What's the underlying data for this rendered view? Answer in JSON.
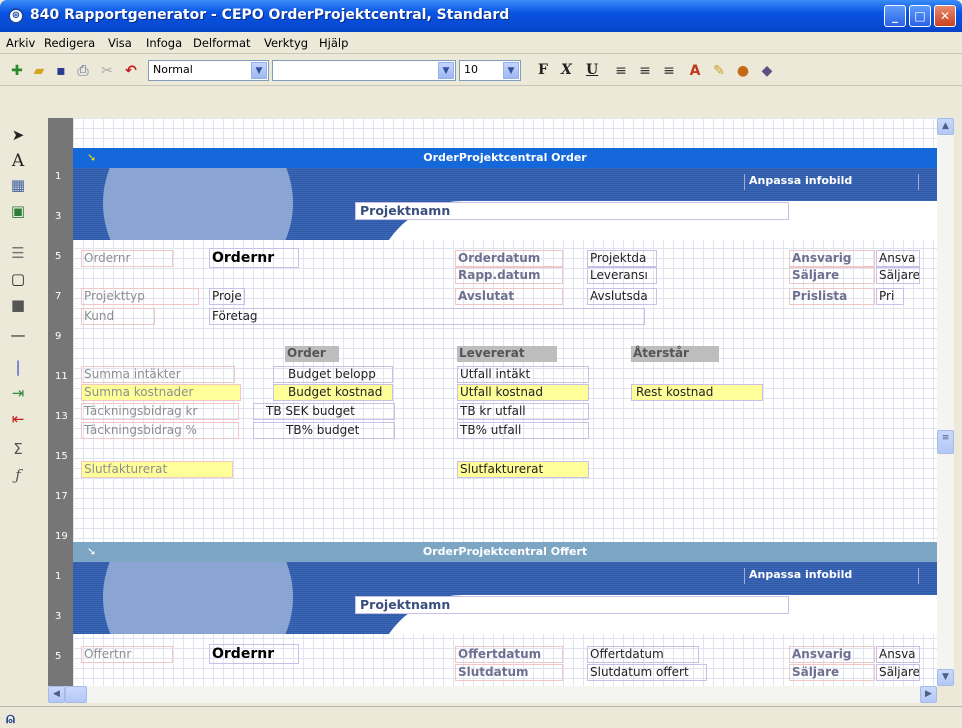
{
  "window": {
    "title": "840 Rapportgenerator - CEPO  OrderProjektcentral, Standard",
    "minimize": "_",
    "maximize": "□",
    "close": "✕"
  },
  "menu": [
    "Arkiv",
    "Redigera",
    "Visa",
    "Infoga",
    "Delformat",
    "Verktyg",
    "Hjälp"
  ],
  "toolbar": {
    "style_value": "Normal",
    "font_value": "",
    "size_value": "10",
    "bold": "F",
    "italic": "X",
    "underline": "U"
  },
  "ruler": [
    "1",
    "3",
    "5",
    "7",
    "9",
    "11",
    "13",
    "15",
    "17",
    "19",
    "1",
    "3",
    "5"
  ],
  "order_section": {
    "bar_title": "OrderProjektcentral  Order",
    "anpassa": "Anpassa infobild",
    "projektnamn": "Projektnamn",
    "ordernr_label": "Ordernr",
    "ordernr_value": "Ordernr",
    "orderdatum_label": "Orderdatum",
    "orderdatum_value": "Projektda",
    "rappdatum_label": "Rapp.datum",
    "rappdatum_value": "Leveransı",
    "avslutat_label": "Avslutat",
    "avslutat_value": "Avslutsda",
    "ansvarig_label": "Ansvarig",
    "ansvarig_value": "Ansva",
    "saljare_label": "Säljare",
    "saljare_value": "Säljare",
    "prislista_label": "Prislista",
    "prislista_value": "Pri",
    "projekttyp_label": "Projekttyp",
    "projekttyp_value": "Proje",
    "kund_label": "Kund",
    "kund_value": "Företag",
    "col_order": "Order",
    "col_levererat": "Levererat",
    "col_aterstar": "Återstår",
    "rows": [
      {
        "label": "Summa intäkter",
        "order": "Budget belopp",
        "lev": "Utfall intäkt",
        "ater": ""
      },
      {
        "label": "Summa kostnader",
        "order": "Budget kostnad",
        "lev": "Utfall kostnad",
        "ater": "Rest kostnad"
      },
      {
        "label": "Täckningsbidrag kr",
        "order": "TB SEK budget",
        "lev": "TB kr utfall",
        "ater": ""
      },
      {
        "label": "Täckningsbidrag %",
        "order": "TB% budget",
        "lev": "TB% utfall",
        "ater": ""
      }
    ],
    "slutfak_label": "Slutfakturerat",
    "slutfak_value": "Slutfakturerat"
  },
  "offert_section": {
    "bar_title": "OrderProjektcentral  Offert",
    "anpassa": "Anpassa infobild",
    "projektnamn": "Projektnamn",
    "offertnr_label": "Offertnr",
    "offertnr_value": "Ordernr",
    "offertdatum_label": "Offertdatum",
    "offertdatum_value": "Offertdatum",
    "slutdatum_label": "Slutdatum",
    "slutdatum_value": "Slutdatum offert",
    "ansvarig_label": "Ansvarig",
    "ansvarig_value": "Ansva",
    "saljare_label": "Säljare",
    "saljare_value": "Säljare"
  }
}
